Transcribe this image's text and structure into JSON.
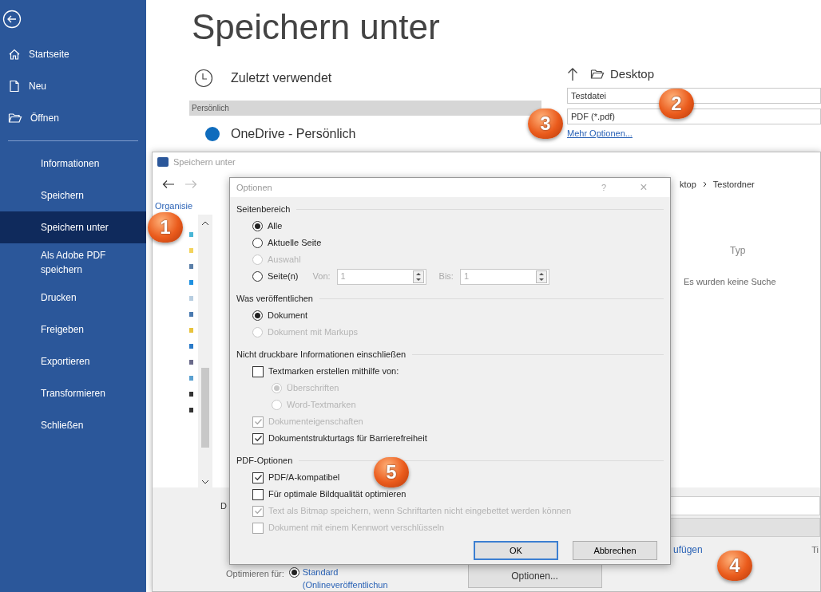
{
  "sidebar": {
    "top_items": [
      {
        "label": "Startseite"
      },
      {
        "label": "Neu"
      },
      {
        "label": "Öffnen"
      }
    ],
    "items": [
      {
        "label": "Informationen",
        "selected": false
      },
      {
        "label": "Speichern",
        "selected": false
      },
      {
        "label": "Speichern unter",
        "selected": true
      },
      {
        "label": "Als Adobe PDF speichern",
        "selected": false
      },
      {
        "label": "Drucken",
        "selected": false
      },
      {
        "label": "Freigeben",
        "selected": false
      },
      {
        "label": "Exportieren",
        "selected": false
      },
      {
        "label": "Transformieren",
        "selected": false
      },
      {
        "label": "Schließen",
        "selected": false
      }
    ]
  },
  "backstage": {
    "title": "Speichern unter",
    "recent": "Zuletzt verwendet",
    "section_header": "Persönlich",
    "onedrive": "OneDrive - Persönlich",
    "location": "Desktop",
    "filename": "Testdatei",
    "filetype": "PDF (*.pdf)",
    "more_link": "Mehr Optionen..."
  },
  "save_dialog": {
    "title": "Speichern unter",
    "breadcrumb": [
      "ktop",
      "Testordner"
    ],
    "organize": "Organisie",
    "column": "Typ",
    "empty_message": "Es wurden keine Suche",
    "filename_label": "D",
    "link": "ufügen",
    "column_2": "Ti",
    "optimize_label": "Optimieren für:",
    "optimize_option": {
      "label": "Standard",
      "sublabel": "(Onlineveröffentlichun",
      "selected": true
    },
    "options_button": "Optionen..."
  },
  "options_dialog": {
    "title": "Optionen",
    "help": "?",
    "close": "×",
    "sections": [
      {
        "title": "Seitenbereich",
        "items": [
          {
            "kind": "radio",
            "label": "Alle",
            "selected": true,
            "disabled": false
          },
          {
            "kind": "radio",
            "label": "Aktuelle Seite",
            "selected": false,
            "disabled": false
          },
          {
            "kind": "radio",
            "label": "Auswahl",
            "selected": false,
            "disabled": true
          },
          {
            "kind": "range",
            "label": "Seite(n)",
            "selected": false,
            "disabled": false,
            "from_label": "Von:",
            "from_value": "1",
            "to_label": "Bis:",
            "to_value": "1"
          }
        ]
      },
      {
        "title": "Was veröffentlichen",
        "items": [
          {
            "kind": "radio",
            "label": "Dokument",
            "selected": true,
            "disabled": false
          },
          {
            "kind": "radio",
            "label": "Dokument mit Markups",
            "selected": false,
            "disabled": true
          }
        ]
      },
      {
        "title": "Nicht druckbare Informationen einschließen",
        "items": [
          {
            "kind": "checkbox",
            "label": "Textmarken erstellen mithilfe von:",
            "checked": false,
            "disabled": false,
            "children": [
              {
                "kind": "radio",
                "label": "Überschriften",
                "selected": true,
                "disabled": true
              },
              {
                "kind": "radio",
                "label": "Word-Textmarken",
                "selected": false,
                "disabled": true
              }
            ]
          },
          {
            "kind": "checkbox",
            "label": "Dokumenteigenschaften",
            "checked": true,
            "disabled": true
          },
          {
            "kind": "checkbox",
            "label": "Dokumentstrukturtags für Barrierefreiheit",
            "checked": true,
            "disabled": false
          }
        ]
      },
      {
        "title": "PDF-Optionen",
        "items": [
          {
            "kind": "checkbox",
            "label": "PDF/A-kompatibel",
            "checked": true,
            "disabled": false
          },
          {
            "kind": "checkbox",
            "label": "Für optimale Bildqualität optimieren",
            "checked": false,
            "disabled": false
          },
          {
            "kind": "checkbox",
            "label": "Text als Bitmap speichern, wenn Schriftarten nicht eingebettet werden können",
            "checked": true,
            "disabled": true
          },
          {
            "kind": "checkbox",
            "label": "Dokument mit einem Kennwort verschlüsseln",
            "checked": false,
            "disabled": true
          }
        ]
      }
    ],
    "buttons": [
      {
        "label": "OK",
        "default": true
      },
      {
        "label": "Abbrechen",
        "default": false
      }
    ]
  },
  "badges": [
    {
      "number": "1"
    },
    {
      "number": "2"
    },
    {
      "number": "3"
    },
    {
      "number": "4"
    },
    {
      "number": "5"
    }
  ]
}
